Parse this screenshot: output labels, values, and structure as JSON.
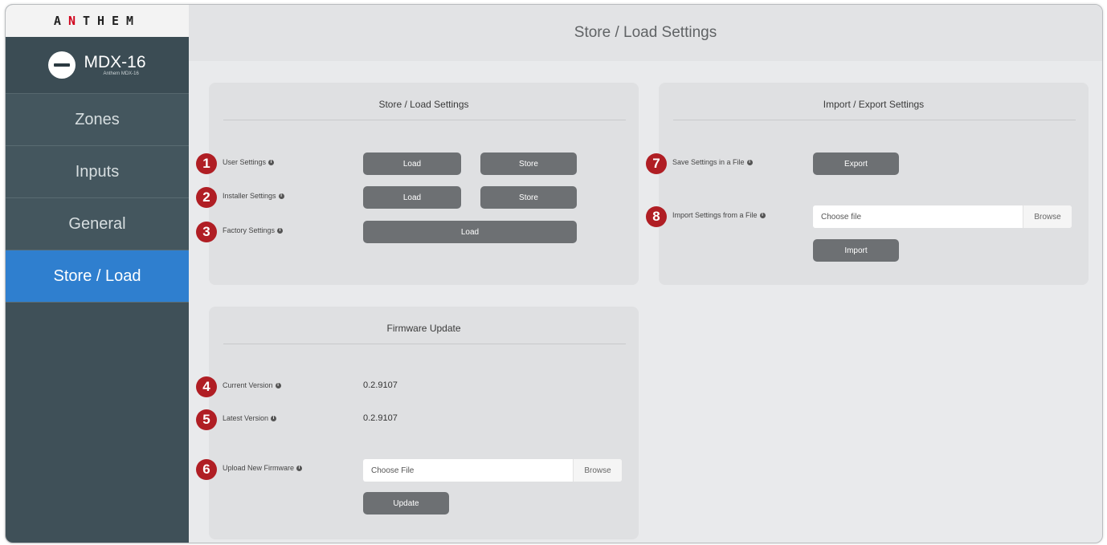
{
  "brand": {
    "logo_text_a": "A",
    "logo_text_n": "N",
    "logo_text_rest": "THEM"
  },
  "device": {
    "model": "MDX-16",
    "subtitle": "Anthem MDX-16"
  },
  "sidebar": {
    "items": [
      {
        "label": "Zones",
        "active": false
      },
      {
        "label": "Inputs",
        "active": false
      },
      {
        "label": "General",
        "active": false
      },
      {
        "label": "Store / Load",
        "active": true
      }
    ]
  },
  "header": {
    "title": "Store / Load Settings"
  },
  "store_load": {
    "title": "Store / Load Settings",
    "user": {
      "badge": "1",
      "label": "User Settings",
      "load": "Load",
      "store": "Store"
    },
    "installer": {
      "badge": "2",
      "label": "Installer Settings",
      "load": "Load",
      "store": "Store"
    },
    "factory": {
      "badge": "3",
      "label": "Factory Settings",
      "load": "Load"
    }
  },
  "import_export": {
    "title": "Import / Export Settings",
    "save": {
      "badge": "7",
      "label": "Save Settings in a File",
      "button": "Export"
    },
    "import": {
      "badge": "8",
      "label": "Import Settings from a File",
      "placeholder": "Choose file",
      "browse": "Browse",
      "button": "Import"
    }
  },
  "firmware": {
    "title": "Firmware Update",
    "current": {
      "badge": "4",
      "label": "Current Version",
      "value": "0.2.9107"
    },
    "latest": {
      "badge": "5",
      "label": "Latest Version",
      "value": "0.2.9107"
    },
    "upload": {
      "badge": "6",
      "label": "Upload New Firmware",
      "placeholder": "Choose File",
      "browse": "Browse",
      "button": "Update"
    }
  },
  "colors": {
    "accent": "#2f7fcf",
    "sidebar": "#3f5058",
    "badge": "#b01e24",
    "button": "#6d7073"
  }
}
